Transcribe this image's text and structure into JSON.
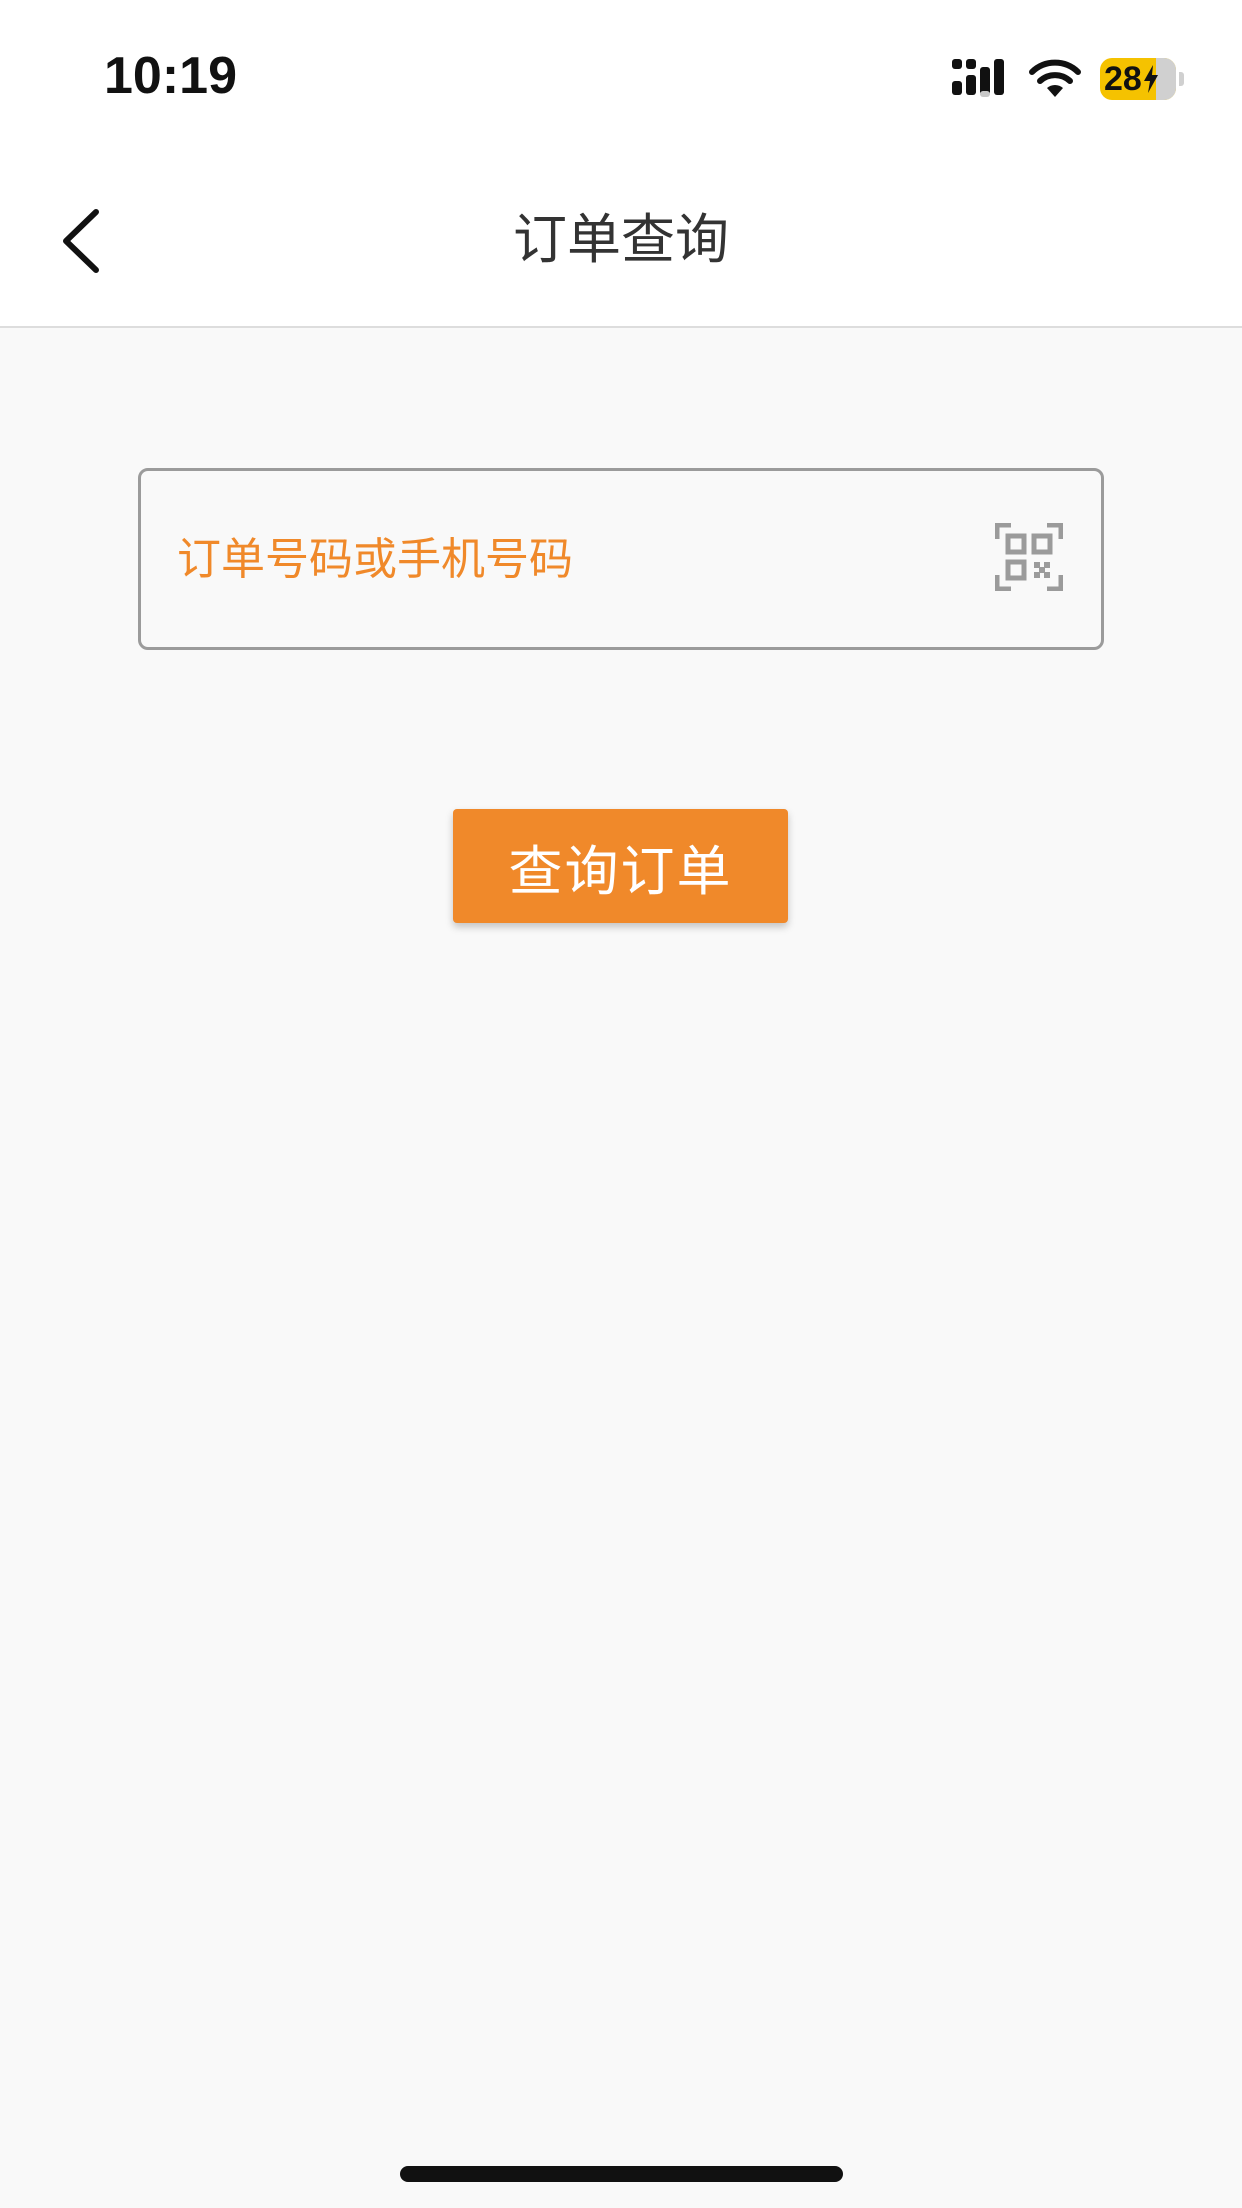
{
  "status_bar": {
    "time": "10:19",
    "battery_level": "28",
    "battery_color": "#f5c200",
    "icons": [
      "cellular-signal-icon",
      "wifi-icon",
      "battery-icon",
      "charging-bolt-icon"
    ]
  },
  "nav": {
    "title": "订单查询",
    "back_icon": "chevron-left-icon"
  },
  "search": {
    "placeholder": "订单号码或手机号码",
    "value": "",
    "scan_icon": "qr-code-scan-icon"
  },
  "actions": {
    "query_label": "查询订单"
  },
  "colors": {
    "accent": "#f0892a",
    "background": "#f9f9f9",
    "nav_background": "#ffffff",
    "title_text": "#333333",
    "border": "#9b9b9b"
  }
}
